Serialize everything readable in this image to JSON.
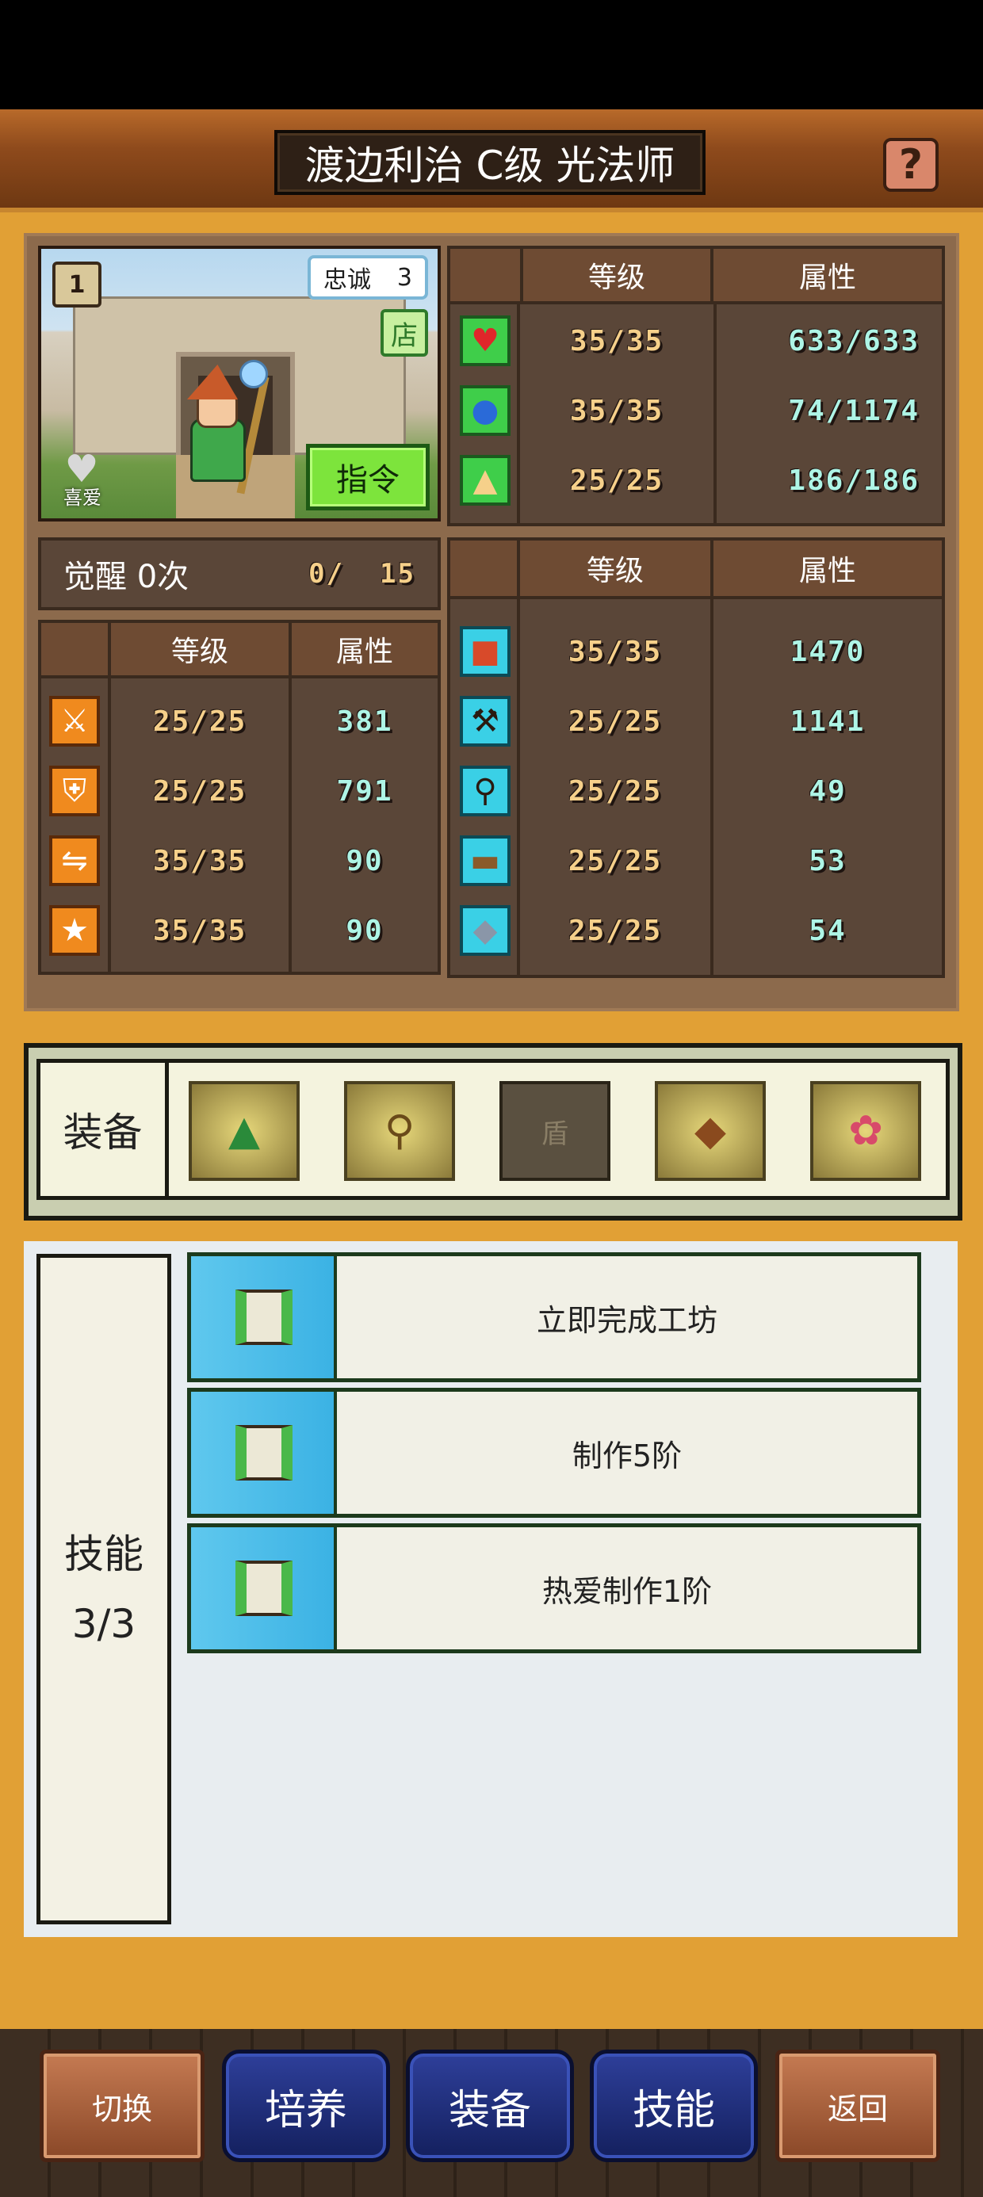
{
  "header": {
    "title": "渡边利治 C级 光法师",
    "help_icon": "?"
  },
  "portrait": {
    "rank_badge": "1",
    "loyalty_label": "忠诚",
    "loyalty_value": "3",
    "shop_label": "店",
    "command_label": "指令",
    "favorite_label": "喜爱"
  },
  "vitals": {
    "headers": [
      "等级",
      "属性"
    ],
    "rows": [
      {
        "icon": "heart-icon",
        "level": "35/35",
        "value": "633/633"
      },
      {
        "icon": "mana-potion-icon",
        "level": "35/35",
        "value": "74/1174"
      },
      {
        "icon": "stamina-icon",
        "level": "25/25",
        "value": "186/186"
      }
    ]
  },
  "awaken": {
    "label": "觉醒 0次",
    "progress": "0/",
    "max": "15"
  },
  "combat": {
    "headers": [
      "等级",
      "属性"
    ],
    "rows": [
      {
        "icon": "sword-icon",
        "level": "25/25",
        "value": "381"
      },
      {
        "icon": "shield-icon",
        "level": "25/25",
        "value": "791"
      },
      {
        "icon": "speed-icon",
        "level": "35/35",
        "value": "90"
      },
      {
        "icon": "star-icon",
        "level": "35/35",
        "value": "90"
      }
    ]
  },
  "crafting": {
    "headers": [
      "等级",
      "属性"
    ],
    "rows": [
      {
        "icon": "book-icon",
        "level": "35/35",
        "value": "1470"
      },
      {
        "icon": "hammer-icon",
        "level": "25/25",
        "value": "1141"
      },
      {
        "icon": "shovel-icon",
        "level": "25/25",
        "value": "49"
      },
      {
        "icon": "chest-icon",
        "level": "25/25",
        "value": "53"
      },
      {
        "icon": "ore-icon",
        "level": "25/25",
        "value": "54"
      }
    ]
  },
  "equipment": {
    "label": "装备",
    "slots": [
      {
        "icon": "hat-icon",
        "glyph": "▲"
      },
      {
        "icon": "staff-icon",
        "glyph": "⚲"
      },
      {
        "icon": "shield-slot-empty",
        "label": "盾"
      },
      {
        "icon": "armor-icon",
        "glyph": "◆"
      },
      {
        "icon": "necklace-icon",
        "glyph": "✿"
      }
    ]
  },
  "skills": {
    "label": "技能",
    "count": "3/3",
    "items": [
      {
        "label": "立即完成工坊"
      },
      {
        "label": "制作5阶"
      },
      {
        "label": "热爱制作1阶"
      }
    ]
  },
  "nav": {
    "switch": "切换",
    "train": "培养",
    "equip": "装备",
    "skill": "技能",
    "back": "返回"
  }
}
